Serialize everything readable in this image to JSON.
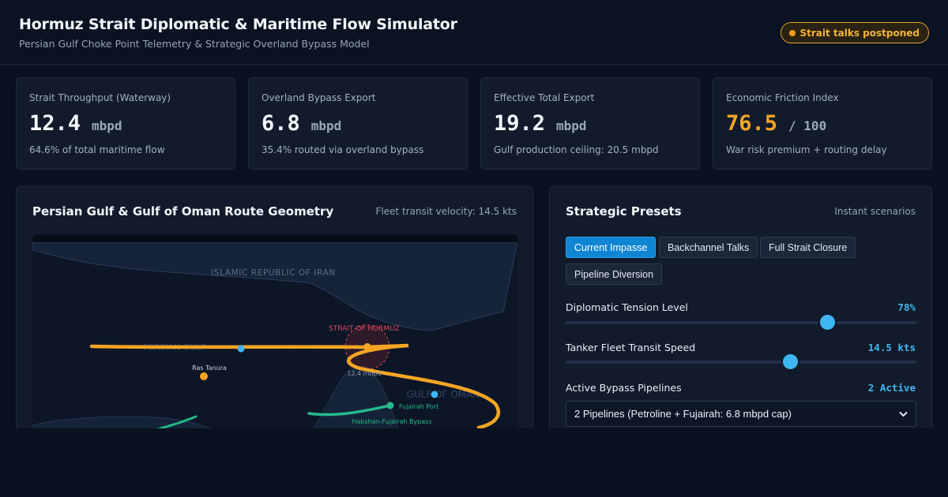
{
  "header": {
    "title": "Hormuz Strait Diplomatic & Maritime Flow Simulator",
    "subtitle": "Persian Gulf Choke Point Telemetry & Strategic Overland Bypass Model",
    "status_badge": "Strait talks postponed",
    "status_color": "#f29f19"
  },
  "kpis": [
    {
      "label": "Strait Throughput (Waterway)",
      "value": "12.4",
      "unit": "mbpd",
      "note": "64.6% of total maritime flow"
    },
    {
      "label": "Overland Bypass Export",
      "value": "6.8",
      "unit": "mbpd",
      "note": "35.4% routed via overland bypass"
    },
    {
      "label": "Effective Total Export",
      "value": "19.2",
      "unit": "mbpd",
      "note": "Gulf production ceiling: 20.5 mbpd"
    },
    {
      "label": "Economic Friction Index",
      "value": "76.5",
      "unit": "/ 100",
      "note": "War risk premium + routing delay",
      "value_color": "#f5a524"
    }
  ],
  "map_panel": {
    "title": "Persian Gulf & Gulf of Oman Route Geometry",
    "meta": "Fleet transit velocity: 14.5 kts",
    "labels": {
      "iran": "ISLAMIC REPUBLIC OF IRAN",
      "persian_gulf": "PERSIAN GULF",
      "strait": "STRAIT OF HORMUZ",
      "strait_flow": "12.4 mbpd",
      "gulf_of_oman": "GULF OF OMAN",
      "ras_tanura": "Ras Tanura",
      "fujairah": "Fujairah Port",
      "bypass": "Habshan-Fujairah Bypass"
    },
    "colors": {
      "tanker_route": "#f5a524",
      "bypass_route": "#25b98a",
      "vessel": "#3fb6f2",
      "strait_label": "#e04a5f"
    }
  },
  "presets_panel": {
    "title": "Strategic Presets",
    "meta": "Instant scenarios",
    "presets": [
      {
        "label": "Current Impasse",
        "active": true
      },
      {
        "label": "Backchannel Talks",
        "active": false
      },
      {
        "label": "Full Strait Closure",
        "active": false
      },
      {
        "label": "Pipeline Diversion",
        "active": false
      }
    ],
    "tension": {
      "label": "Diplomatic Tension Level",
      "value": "78%",
      "level": 0.745
    },
    "speed": {
      "label": "Tanker Fleet Transit Speed",
      "value": "14.5 kts",
      "level": 0.64
    },
    "pipelines": {
      "label": "Active Bypass Pipelines",
      "value": "2 Active",
      "selected": "2 Pipelines (Petroline + Fujairah: 6.8 mbpd cap)"
    }
  }
}
